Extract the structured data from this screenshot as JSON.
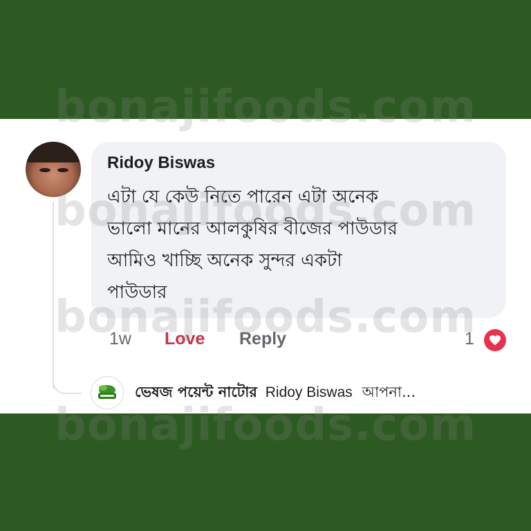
{
  "comment": {
    "author": "Ridoy Biswas",
    "text_lines": [
      "এটা যে কেউ নিতে পারেন এটা অনেক",
      "ভালো মানের আলকুষির বীজের পাউডার",
      "আমিও খাচ্ছি অনেক সুন্দর একটা",
      "পাউডার"
    ],
    "time": "1w",
    "love_label": "Love",
    "reply_label": "Reply",
    "reaction_count": "1",
    "reaction_icon": "heart-icon"
  },
  "reply": {
    "page_name": "ভেষজ পয়েন্ট নাটোর",
    "mention": "Ridoy Biswas",
    "snippet": "আপনা..."
  },
  "watermark": {
    "text": "bonajifoods.com"
  },
  "colors": {
    "band": "#2d5a22",
    "bubble": "#f0f2f5",
    "love": "#c8334a",
    "heart_badge": "#e8304f"
  }
}
